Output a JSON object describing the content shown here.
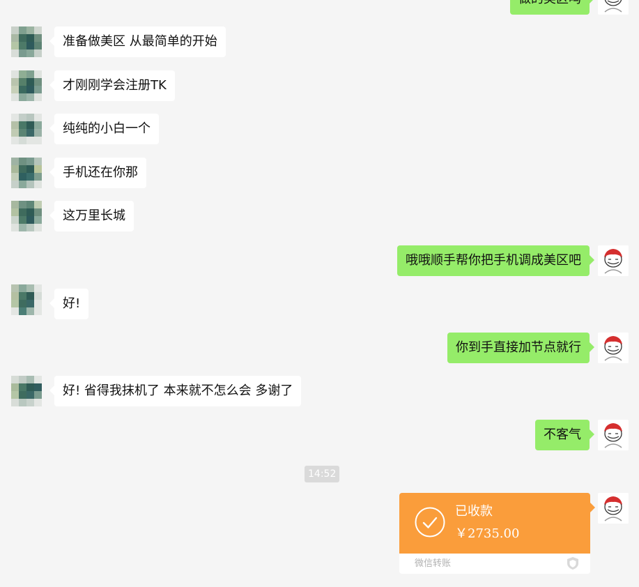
{
  "chat": {
    "messages": [
      {
        "side": "right",
        "text": "做的美区吗"
      },
      {
        "side": "left",
        "text": "准备做美区 从最简单的开始"
      },
      {
        "side": "left",
        "text": "才刚刚学会注册TK"
      },
      {
        "side": "left",
        "text": "纯纯的小白一个"
      },
      {
        "side": "left",
        "text": "手机还在你那"
      },
      {
        "side": "left",
        "text": "这万里长城"
      },
      {
        "side": "right",
        "text": "哦哦顺手帮你把手机调成美区吧"
      },
      {
        "side": "left",
        "text": "好!"
      },
      {
        "side": "right",
        "text": "你到手直接加节点就行"
      },
      {
        "side": "left",
        "text": "好! 省得我抹机了 本来就不怎么会 多谢了"
      },
      {
        "side": "right",
        "text": "不客气"
      }
    ],
    "timestamp": "14:52",
    "transfer": {
      "status": "已收款",
      "amount": "￥2735.00",
      "source": "微信转账",
      "color": "#fa9d3b"
    }
  },
  "icons": {
    "contact_avatar": "pixelated-avatar",
    "self_avatar": "cartoon-avatar",
    "transfer_check": "check-circle-icon",
    "transfer_logo": "wechat-pay-shield-icon"
  },
  "colors": {
    "background": "#f5f5f5",
    "bubble_self": "#95ec69",
    "bubble_other": "#ffffff"
  }
}
